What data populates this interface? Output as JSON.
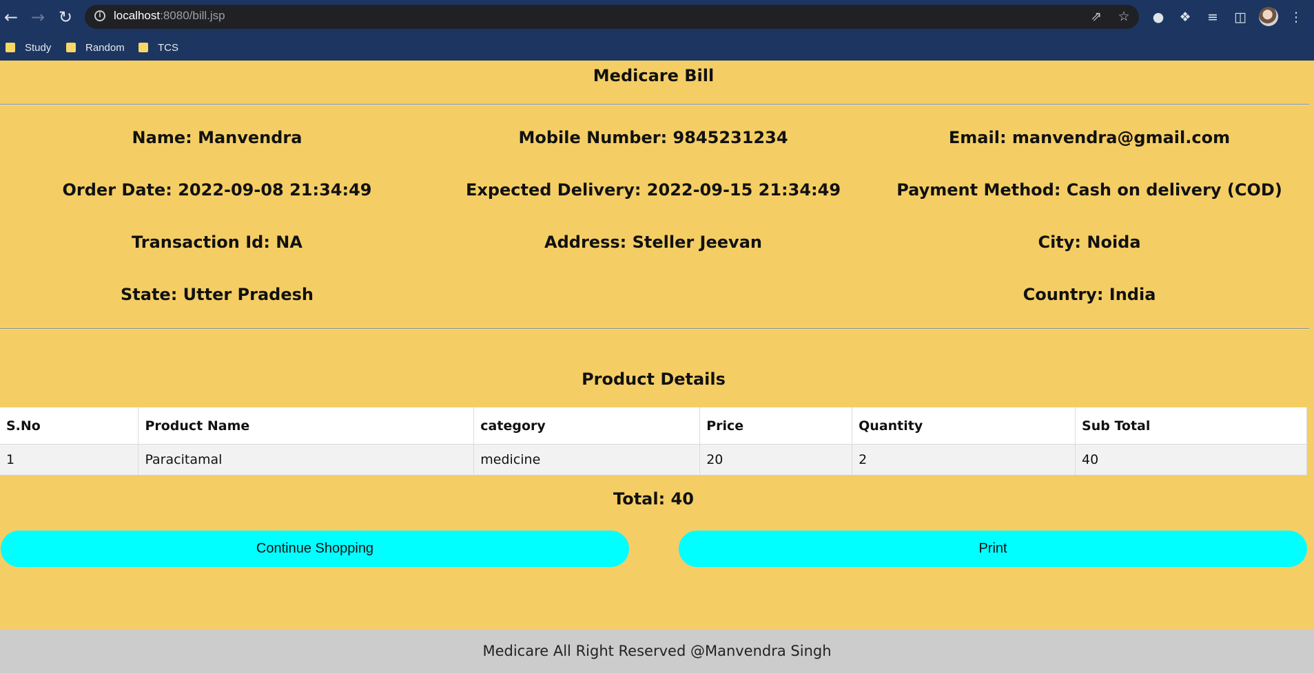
{
  "browser": {
    "url_host": "localhost",
    "url_path": ":8080/bill.jsp",
    "bookmarks": [
      {
        "label": "Study"
      },
      {
        "label": "Random"
      },
      {
        "label": "TCS"
      }
    ]
  },
  "page": {
    "title": "Medicare Bill",
    "info_rows": [
      [
        "Name: Manvendra",
        "Mobile Number: 9845231234",
        "Email: manvendra@gmail.com"
      ],
      [
        "Order Date: 2022-09-08 21:34:49",
        "Expected Delivery: 2022-09-15 21:34:49",
        "Payment Method: Cash on delivery (COD)"
      ],
      [
        "Transaction Id: NA",
        "Address: Steller Jeevan",
        "City: Noida"
      ],
      [
        "State: Utter Pradesh",
        "",
        "Country: India"
      ]
    ],
    "product_section_title": "Product Details",
    "table": {
      "headers": [
        "S.No",
        "Product Name",
        "category",
        "Price",
        "Quantity",
        "Sub Total"
      ],
      "rows": [
        [
          "1",
          "Paracitamal",
          "medicine",
          "20",
          "2",
          "40"
        ]
      ]
    },
    "total": "Total: 40",
    "buttons": {
      "continue": "Continue Shopping",
      "print": "Print"
    },
    "footer": "Medicare All Right Reserved @Manvendra Singh"
  },
  "colors": {
    "page_bg": "#f4ce64",
    "button_bg": "#00ffff",
    "chrome_bg": "#1c3661",
    "footer_bg": "#cccccc"
  }
}
